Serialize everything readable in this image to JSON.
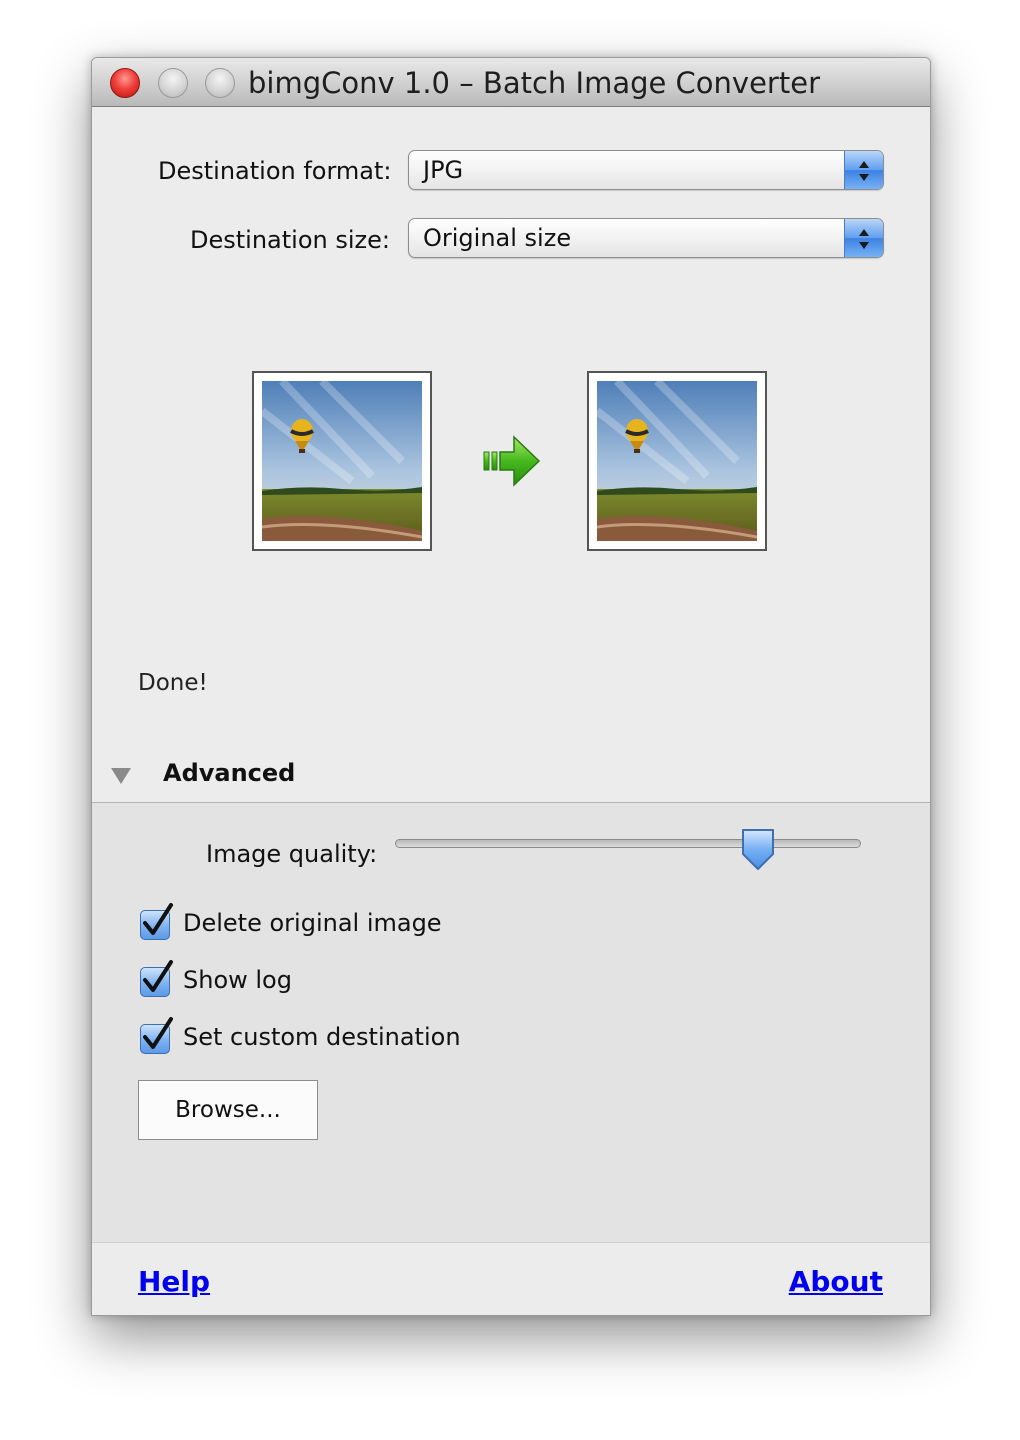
{
  "window": {
    "title": "bimgConv 1.0 – Batch Image Converter"
  },
  "form": {
    "format_label": "Destination format:",
    "format_value": "JPG",
    "size_label": "Destination size:",
    "size_value": "Original size"
  },
  "preview": {
    "source_icon": "photo-thumbnail",
    "arrow_icon": "green-arrow-right-icon",
    "result_icon": "photo-thumbnail"
  },
  "status": {
    "text": "Done!"
  },
  "advanced": {
    "label": "Advanced",
    "expanded": true,
    "quality_label": "Image quality:",
    "quality_value": 0.78,
    "options": [
      {
        "label": "Delete original image",
        "checked": true
      },
      {
        "label": "Show log",
        "checked": true
      },
      {
        "label": "Set custom destination",
        "checked": true
      }
    ],
    "browse_label": "Browse..."
  },
  "footer": {
    "help_label": "Help",
    "about_label": "About"
  },
  "colors": {
    "accent": "#3c82e2",
    "link": "#0000ee",
    "close_button": "#f0403a",
    "arrow": "#3cb21a"
  }
}
